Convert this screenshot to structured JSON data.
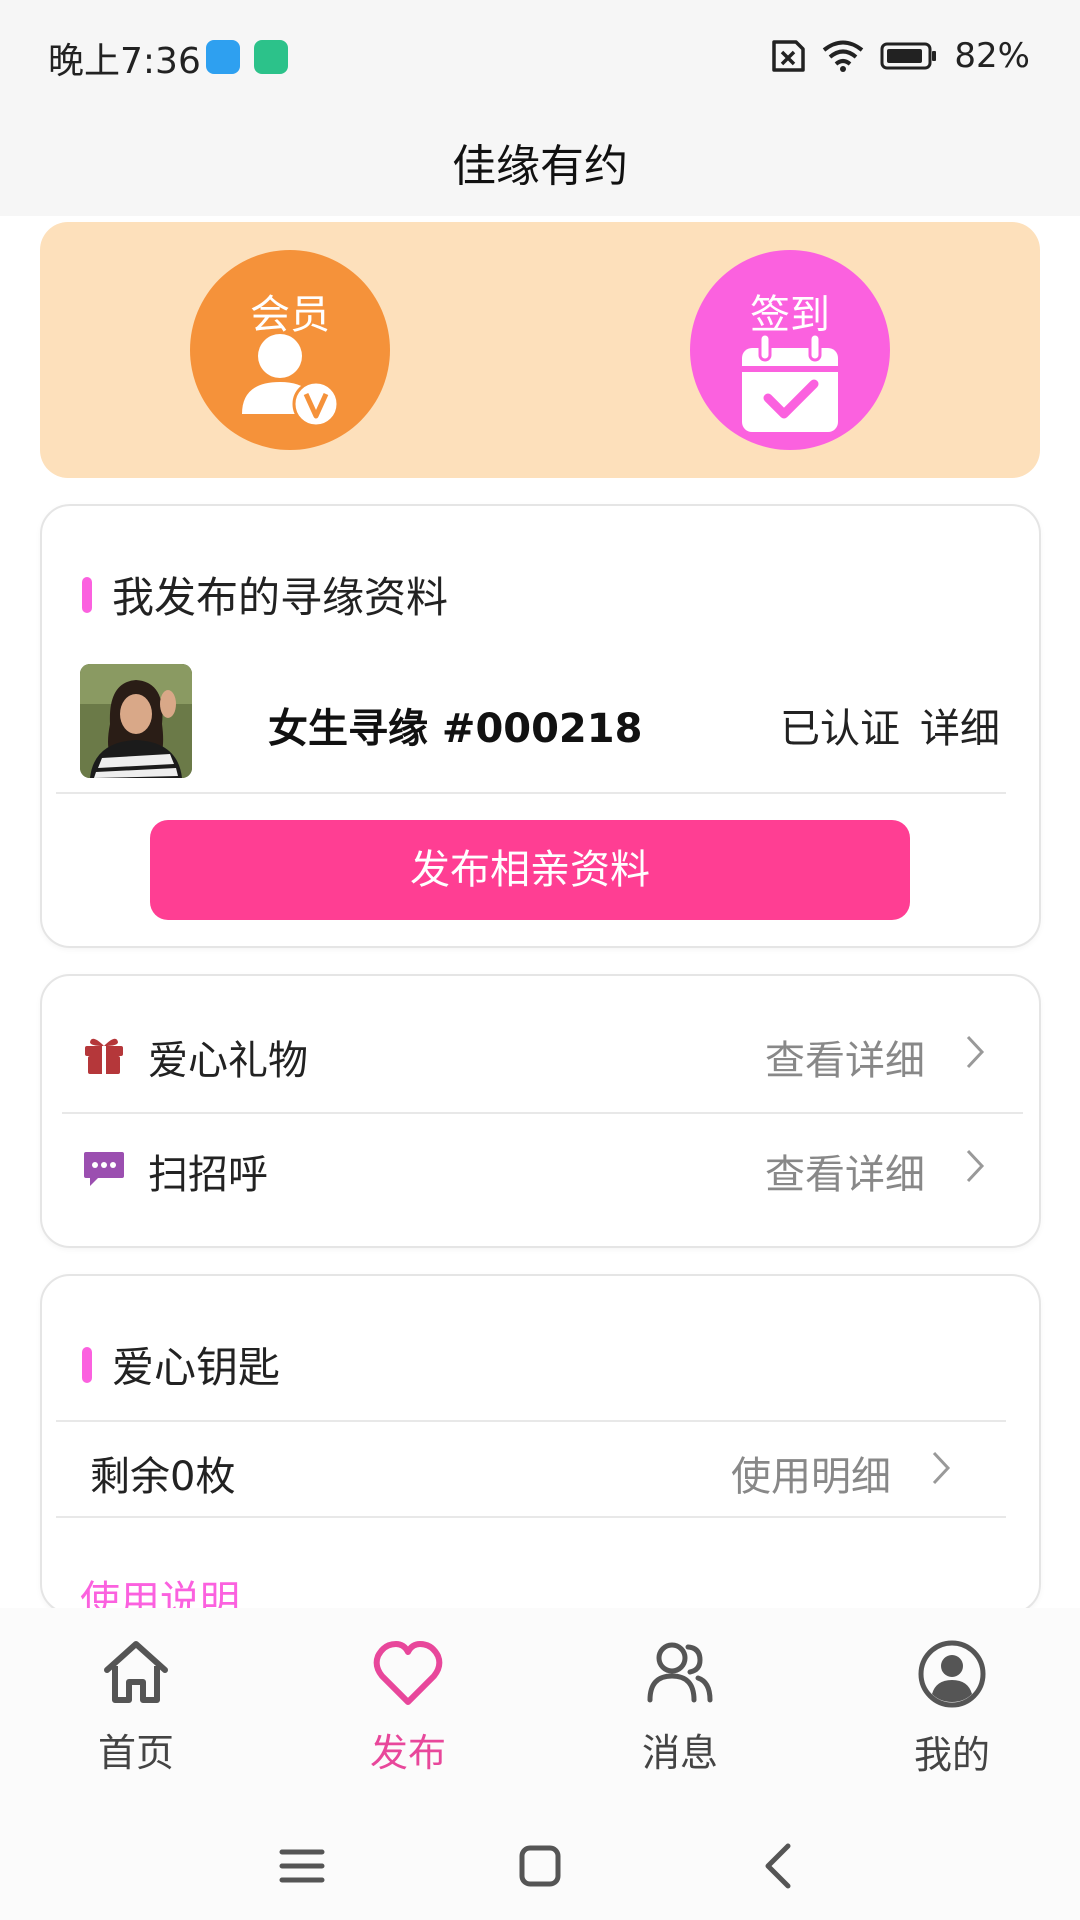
{
  "status_bar": {
    "time": "晚上7:36",
    "battery": "82%"
  },
  "header": {
    "title": "佳缘有约"
  },
  "banner": {
    "member_label": "会员",
    "signin_label": "签到",
    "background_color": "#fde0bb",
    "member_color": "#f5923a",
    "signin_color": "#fb61df"
  },
  "publish_card": {
    "section_title": "我发布的寻缘资料",
    "profile": {
      "name": "女生寻缘 #000218",
      "status": "已认证",
      "detail_link": "详细"
    },
    "publish_button": "发布相亲资料",
    "button_color": "#ff3e93"
  },
  "menu_card": {
    "items": [
      {
        "icon": "gift-icon",
        "label": "爱心礼物",
        "action": "查看详细"
      },
      {
        "icon": "chat-bubble-icon",
        "label": "扫招呼",
        "action": "查看详细"
      }
    ]
  },
  "key_card": {
    "section_title": "爱心钥匙",
    "remaining": "剩余0枚",
    "action": "使用明细",
    "help_link": "使用说明"
  },
  "bottom_nav": {
    "items": [
      {
        "icon": "home-icon",
        "label": "首页",
        "active": false
      },
      {
        "icon": "heart-icon",
        "label": "发布",
        "active": true
      },
      {
        "icon": "users-icon",
        "label": "消息",
        "active": false
      },
      {
        "icon": "profile-icon",
        "label": "我的",
        "active": false
      }
    ],
    "active_color": "#e8479b"
  }
}
